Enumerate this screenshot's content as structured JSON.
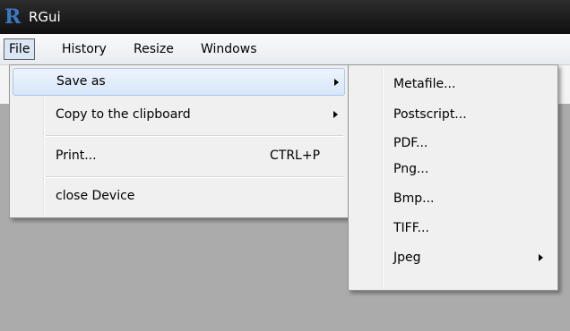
{
  "window": {
    "title": "RGui",
    "logo": "R"
  },
  "menubar": [
    "File",
    "History",
    "Resize",
    "Windows"
  ],
  "file_menu": {
    "items": [
      {
        "label": "Save as",
        "shortcut": "",
        "has_submenu": true,
        "highlighted": true
      },
      {
        "label": "Copy to the clipboard",
        "shortcut": "",
        "has_submenu": true,
        "highlighted": false
      },
      {
        "label": "Print...",
        "shortcut": "CTRL+P",
        "has_submenu": false,
        "highlighted": false
      },
      {
        "label": "close Device",
        "shortcut": "",
        "has_submenu": false,
        "highlighted": false
      }
    ]
  },
  "save_as_menu": {
    "items": [
      {
        "label": "Metafile...",
        "has_submenu": false
      },
      {
        "label": "Postscript...",
        "has_submenu": false
      },
      {
        "label": "PDF...",
        "has_submenu": false
      },
      {
        "label": "Png...",
        "has_submenu": false
      },
      {
        "label": "Bmp...",
        "has_submenu": false
      },
      {
        "label": "TIFF...",
        "has_submenu": false
      },
      {
        "label": "Jpeg",
        "has_submenu": true
      }
    ]
  },
  "colors": {
    "titlebar": "#1a1a1a",
    "workspace": "#ababab",
    "highlight": "#d6e6f8"
  }
}
